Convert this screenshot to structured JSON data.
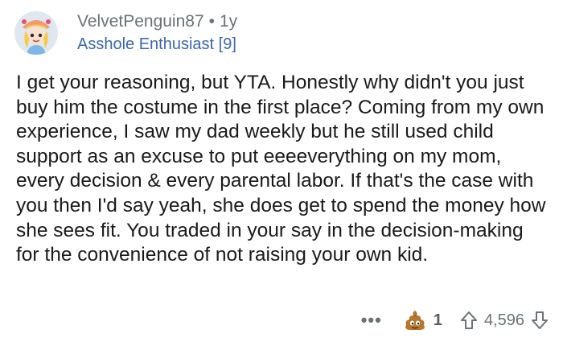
{
  "comment": {
    "username": "VelvetPenguin87",
    "separator": "•",
    "age": "1y",
    "flair": "Asshole Enthusiast [9]",
    "body": "I get your reasoning, but YTA. Honestly why didn't you just buy him the costume in the first place? Coming from my own experience, I saw my dad weekly but he still used child support as an excuse to put eeeeverything on my mom, every decision & every parental labor. If that's the case with you then I'd say yeah, she does get to spend the money how she sees fit. You traded in your say in the decision-making for the convenience of not raising your own kid."
  },
  "actions": {
    "more_label": "•••",
    "award_icon": "poop-award-icon",
    "award_count": "1",
    "score": "4,596",
    "upvote_icon": "upvote-arrow-icon",
    "downvote_icon": "downvote-arrow-icon"
  },
  "colors": {
    "meta_gray": "#6b7378",
    "flair_blue": "#3b67b0",
    "body_text": "#1a1a1b"
  }
}
